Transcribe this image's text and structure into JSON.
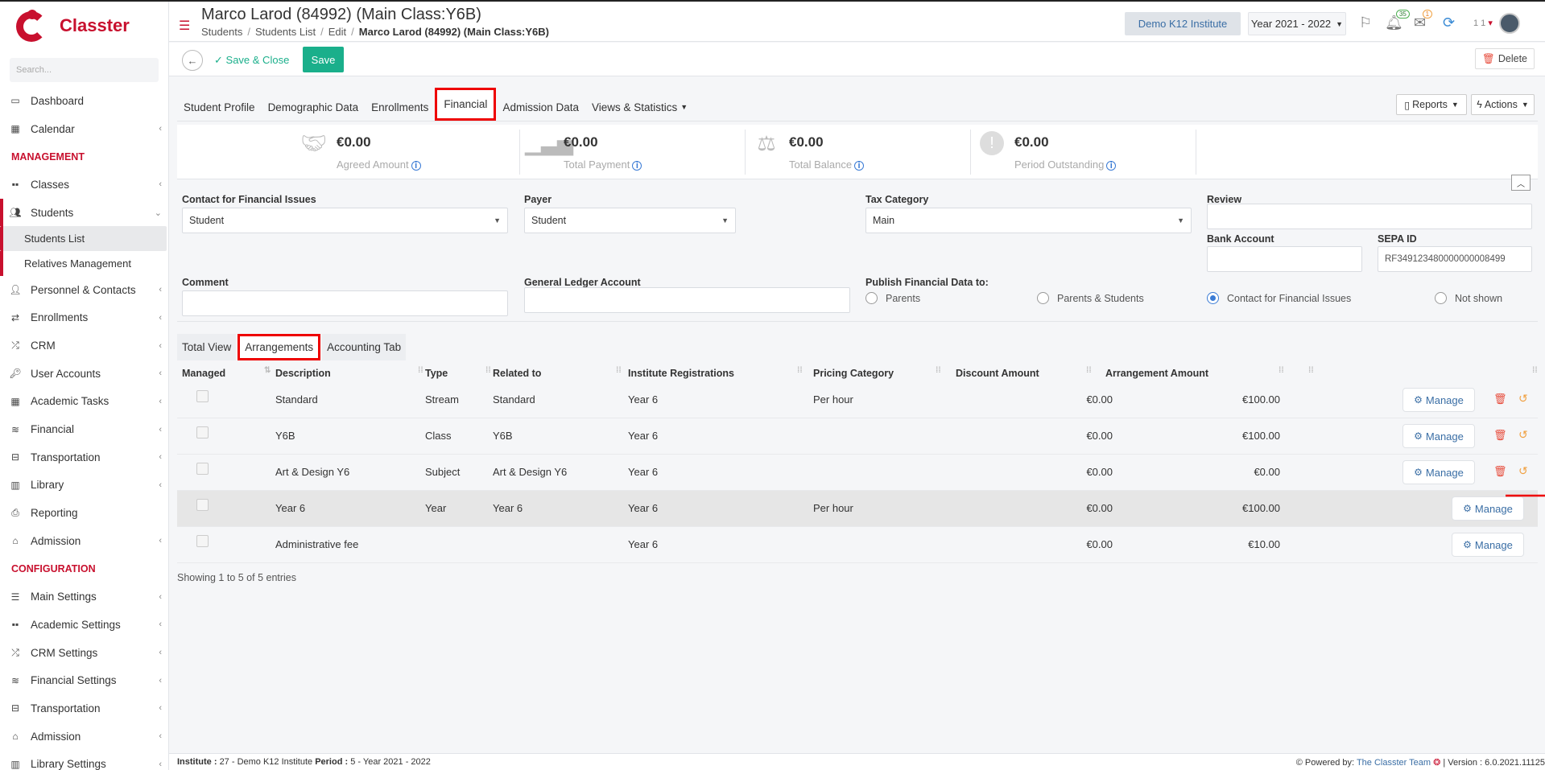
{
  "app": {
    "name": "Classter",
    "search_placeholder": "Search..."
  },
  "sidebar": {
    "items": [
      {
        "label": "Dashboard",
        "icon": "monitor-icon",
        "chevron": false
      },
      {
        "label": "Calendar",
        "icon": "calendar-icon",
        "chevron": true
      }
    ],
    "section_management": "MANAGEMENT",
    "management": [
      {
        "label": "Classes",
        "icon": "classes-icon",
        "chevron": true
      },
      {
        "label": "Students",
        "icon": "students-icon",
        "chevron": true
      }
    ],
    "students_sub": [
      {
        "label": "Students List"
      },
      {
        "label": "Relatives Management"
      }
    ],
    "management2": [
      {
        "label": "Personnel & Contacts",
        "icon": "personnel-icon"
      },
      {
        "label": "Enrollments",
        "icon": "enrollments-icon"
      },
      {
        "label": "CRM",
        "icon": "crm-icon"
      },
      {
        "label": "User Accounts",
        "icon": "key-icon"
      },
      {
        "label": "Academic Tasks",
        "icon": "grid-icon"
      },
      {
        "label": "Financial",
        "icon": "coins-icon"
      },
      {
        "label": "Transportation",
        "icon": "bus-icon"
      },
      {
        "label": "Library",
        "icon": "books-icon"
      },
      {
        "label": "Reporting",
        "icon": "printer-icon"
      },
      {
        "label": "Admission",
        "icon": "bank-icon"
      }
    ],
    "section_configuration": "CONFIGURATION",
    "configuration": [
      {
        "label": "Main Settings",
        "icon": "settings-icon"
      },
      {
        "label": "Academic Settings",
        "icon": "classes-icon"
      },
      {
        "label": "CRM Settings",
        "icon": "crm-icon"
      },
      {
        "label": "Financial Settings",
        "icon": "coins-icon"
      },
      {
        "label": "Transportation",
        "icon": "bus-icon"
      },
      {
        "label": "Admission",
        "icon": "bank-icon"
      },
      {
        "label": "Library Settings",
        "icon": "books-icon"
      }
    ]
  },
  "header": {
    "title": "Marco Larod (84992) (Main Class:Y6B)",
    "breadcrumb": [
      "Students",
      "Students List",
      "Edit",
      "Marco Larod (84992) (Main Class:Y6B)"
    ],
    "institute": "Demo K12 Institute",
    "year": "Year 2021 - 2022",
    "notif_count": "35",
    "mail_count": "1",
    "user_num": "1 1"
  },
  "toolbar": {
    "save_close": "Save & Close",
    "save": "Save",
    "delete": "Delete"
  },
  "tabs": [
    "Student Profile",
    "Demographic Data",
    "Enrollments",
    "Financial",
    "Admission Data",
    "Views & Statistics"
  ],
  "reports": "Reports",
  "actions": "Actions",
  "summary": [
    {
      "value": "€0.00",
      "label": "Agreed Amount"
    },
    {
      "value": "€0.00",
      "label": "Total Payment"
    },
    {
      "value": "€0.00",
      "label": "Total Balance"
    },
    {
      "value": "€0.00",
      "label": "Period Outstanding"
    }
  ],
  "form": {
    "contact_label": "Contact for Financial Issues",
    "contact_value": "Student",
    "payer_label": "Payer",
    "payer_value": "Student",
    "tax_label": "Tax Category",
    "tax_value": "Main",
    "review_label": "Review",
    "bank_label": "Bank Account",
    "sepa_label": "SEPA ID",
    "sepa_value": "RF349123480000000008499",
    "comment_label": "Comment",
    "gl_label": "General Ledger Account",
    "publish_label": "Publish Financial Data to:",
    "publish_options": [
      "Parents",
      "Parents & Students",
      "Contact for Financial Issues",
      "Not shown"
    ],
    "publish_selected": "Contact for Financial Issues"
  },
  "subtabs": [
    "Total View",
    "Arrangements",
    "Accounting Tab"
  ],
  "table": {
    "columns": [
      "Managed",
      "Description",
      "Type",
      "Related to",
      "Institute Registrations",
      "Pricing Category",
      "Discount Amount",
      "Arrangement Amount"
    ],
    "rows": [
      {
        "description": "Standard",
        "type": "Stream",
        "related": "Standard",
        "registrations": "Year 6",
        "pricing": "Per hour",
        "discount": "€0.00",
        "amount": "€100.00",
        "actions": true
      },
      {
        "description": "Y6B",
        "type": "Class",
        "related": "Y6B",
        "registrations": "Year 6",
        "pricing": "",
        "discount": "€0.00",
        "amount": "€100.00",
        "actions": true
      },
      {
        "description": "Art & Design Y6",
        "type": "Subject",
        "related": "Art & Design Y6",
        "registrations": "Year 6",
        "pricing": "",
        "discount": "€0.00",
        "amount": "€0.00",
        "actions": true
      },
      {
        "description": "Year 6",
        "type": "Year",
        "related": "Year 6",
        "registrations": "Year 6",
        "pricing": "Per hour",
        "discount": "€0.00",
        "amount": "€100.00",
        "actions": false
      },
      {
        "description": "Administrative fee",
        "type": "",
        "related": "",
        "registrations": "Year 6",
        "pricing": "",
        "discount": "€0.00",
        "amount": "€10.00",
        "actions": false
      }
    ],
    "manage_label": "Manage",
    "showing": "Showing 1 to 5 of 5 entries"
  },
  "footer": {
    "institute_label": "Institute :",
    "institute_value": "27 - Demo K12 Institute",
    "period_label": "Period :",
    "period_value": "5 - Year 2021 - 2022",
    "powered": "Powered by:",
    "team": "The Classter Team",
    "version": "| Version : 6.0.2021.11125"
  },
  "colors": {
    "brand": "#c8102e",
    "accent": "#1aaf8b",
    "link": "#3a6ea5",
    "highlight": "#e00000"
  }
}
